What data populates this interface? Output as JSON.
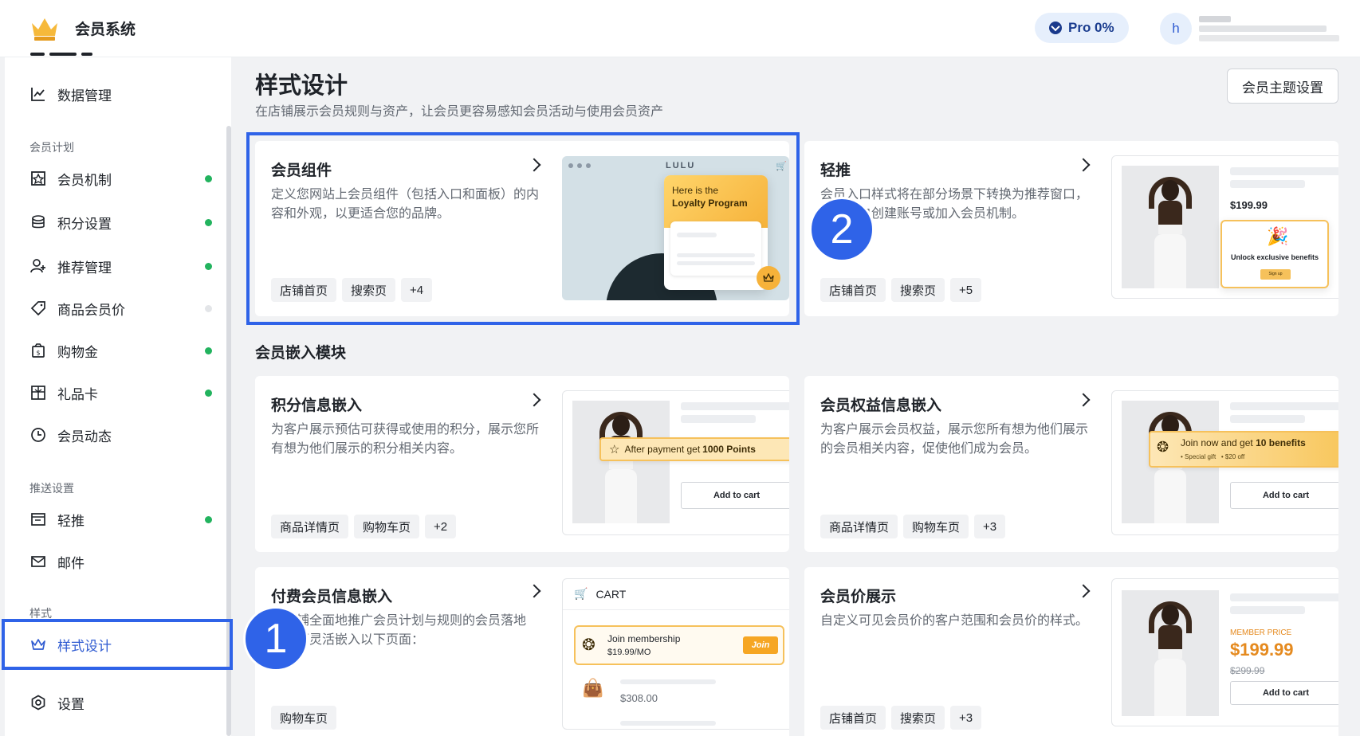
{
  "header": {
    "app_name": "会员系统",
    "pro_label": "Pro 0%",
    "avatar_initial": "h"
  },
  "sidebar": {
    "items_top": [
      {
        "label": "数据管理",
        "icon": "line-chart-icon"
      }
    ],
    "group_plan": "会员计划",
    "plan_items": [
      {
        "label": "会员机制",
        "icon": "badge-icon",
        "enabled": true
      },
      {
        "label": "积分设置",
        "icon": "coins-icon",
        "enabled": true
      },
      {
        "label": "推荐管理",
        "icon": "user-add-icon",
        "enabled": true
      },
      {
        "label": "商品会员价",
        "icon": "tag-icon",
        "enabled": false
      },
      {
        "label": "购物金",
        "icon": "wallet-icon",
        "enabled": true
      },
      {
        "label": "礼品卡",
        "icon": "gift-card-icon",
        "enabled": true
      },
      {
        "label": "会员动态",
        "icon": "clock-icon"
      }
    ],
    "group_push": "推送设置",
    "push_items": [
      {
        "label": "轻推",
        "icon": "window-icon",
        "enabled": true
      },
      {
        "label": "邮件",
        "icon": "mail-icon"
      }
    ],
    "group_style": "样式",
    "style_item": {
      "label": "样式设计",
      "icon": "crown-icon"
    },
    "settings_item": {
      "label": "设置",
      "icon": "gear-icon"
    }
  },
  "main": {
    "title": "样式设计",
    "subtitle": "在店铺展示会员规则与资产，让会员更容易感知会员活动与使用会员资产",
    "theme_button": "会员主题设置",
    "section_embed": "会员嵌入模块",
    "callout_1": "1",
    "callout_2": "2",
    "cards": {
      "widget": {
        "title": "会员组件",
        "desc": "定义您网站上会员组件（包括入口和面板）的内容和外观，以更适合您的品牌。",
        "tags": [
          "店铺首页",
          "搜索页",
          "+4"
        ],
        "preview": {
          "brand": "LULU",
          "line1": "Here is the",
          "line2": "Loyalty Program"
        }
      },
      "nudge": {
        "title": "轻推",
        "desc": "会员入口样式将在部分场景下转换为推荐窗口，帮助客户创建账号或加入会员机制。",
        "tags": [
          "店铺首页",
          "搜索页",
          "+5"
        ],
        "preview": {
          "price": "$199.99",
          "popup_text": "Unlock exclusive benefits",
          "popup_btn": "Sign up"
        }
      },
      "points": {
        "title": "积分信息嵌入",
        "desc": "为客户展示预估可获得或使用的积分，展示您所有想为他们展示的积分相关内容。",
        "tags": [
          "商品详情页",
          "购物车页",
          "+2"
        ],
        "preview": {
          "banner_prefix": "After payment get ",
          "banner_bold": "1000 Points",
          "cart_btn": "Add to cart"
        }
      },
      "benefits": {
        "title": "会员权益信息嵌入",
        "desc": "为客户展示会员权益，展示您所有想为他们展示的会员相关内容，促使他们成为会员。",
        "tags": [
          "商品详情页",
          "购物车页",
          "+3"
        ],
        "preview": {
          "banner_prefix": "Join now and get ",
          "banner_bold": "10 benefits",
          "sub1": "Special gift",
          "sub2": "$20 off",
          "cart_btn": "Add to cart"
        }
      },
      "paid": {
        "title": "付费会员信息嵌入",
        "desc": "在店铺全面地推广会员计划与规则的会员落地页，可灵活嵌入以下页面：",
        "tags": [
          "购物车页"
        ],
        "preview": {
          "cart_title": "CART",
          "join_line1": "Join membership",
          "join_line2": "$19.99/MO",
          "join_btn": "Join",
          "item_price": "$308.00"
        }
      },
      "price": {
        "title": "会员价展示",
        "desc": "自定义可见会员价的客户范围和会员价的样式。",
        "tags": [
          "店铺首页",
          "搜索页",
          "+3"
        ],
        "preview": {
          "member_label": "MEMBER PRICE",
          "member_price": "$199.99",
          "old_price": "$299.99",
          "cart_btn": "Add to cart"
        }
      }
    }
  }
}
